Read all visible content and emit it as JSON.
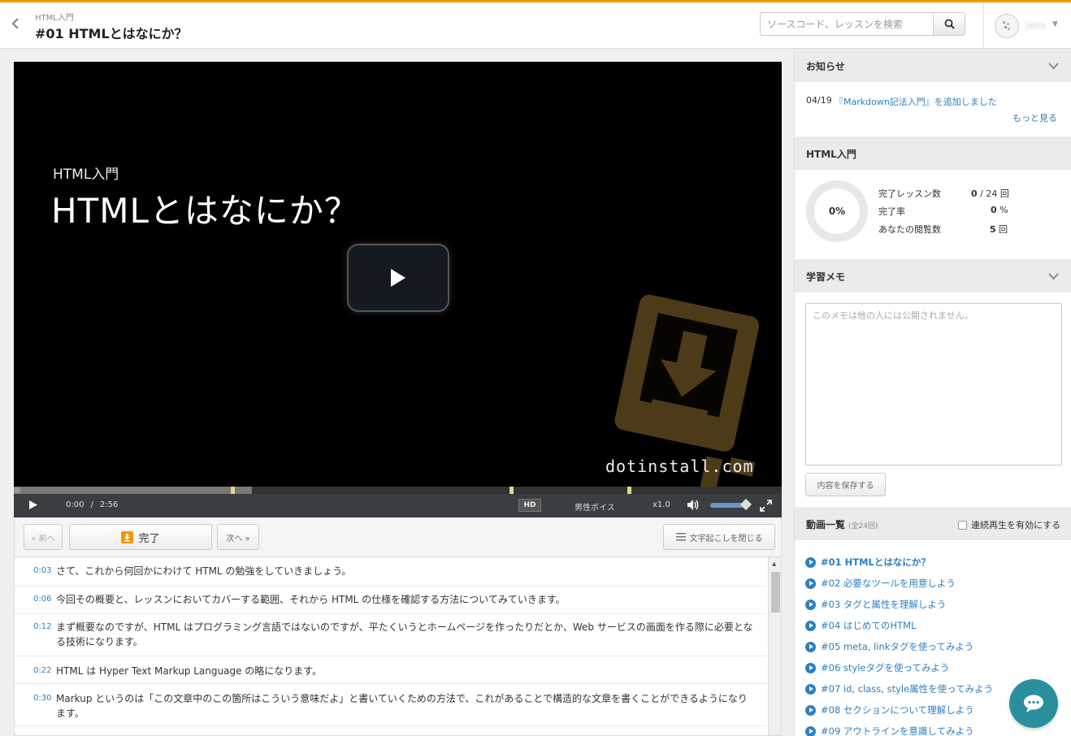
{
  "header": {
    "breadcrumb": "HTML入門",
    "title": "#01 HTMLとはなにか？",
    "search_placeholder": "ソースコード、レッスンを検索",
    "username": "jatro"
  },
  "video": {
    "subtitle": "HTML入門",
    "title": "HTMLとはなにか？",
    "watermark": "dotinstall.com",
    "progress": 0.0,
    "buffered": 0.31
  },
  "controls": {
    "current_time": "0:00",
    "separator": "/",
    "duration": "2:56",
    "hd_label": "HD",
    "voice_label": "男性ボイス",
    "speed_label": "x1.0",
    "volume": 0.9
  },
  "lesson_nav": {
    "prev_label": "« 前へ",
    "done_label": "完了",
    "next_label": "次へ »",
    "close_transcript_label": "文字起こしを閉じる"
  },
  "transcript": [
    {
      "time": "0:03",
      "text": "さて、これから何回かにわけて HTML の勉強をしていきましょう。"
    },
    {
      "time": "0:06",
      "text": "今回その概要と、レッスンにおいてカバーする範囲、それから HTML の仕様を確認する方法についてみていきます。"
    },
    {
      "time": "0:12",
      "text": "まず概要なのですが、HTML はプログラミング言語ではないのですが、平たくいうとホームページを作ったりだとか、Web サービスの画面を作る際に必要となる技術になります。"
    },
    {
      "time": "0:22",
      "text": "HTML は Hyper Text Markup Language の略になります。"
    },
    {
      "time": "0:30",
      "text": "Markup というのは「この文章中のこの箇所はこういう意味だよ」と書いていくための方法で、これがあることで構造的な文章を書くことができるようになります。"
    }
  ],
  "sidebar": {
    "news": {
      "heading": "お知らせ",
      "date": "04/19",
      "link": "『Markdown記法入門』を追加しました",
      "more": "もっと見る"
    },
    "course": {
      "heading": "HTML入門",
      "percent_label": "0%",
      "stats": [
        {
          "label": "完了レッスン数",
          "value": "0",
          "total": "/ 24",
          "unit": "回"
        },
        {
          "label": "完了率",
          "value": "0",
          "total": "",
          "unit": "%"
        },
        {
          "label": "あなたの閲覧数",
          "value": "5",
          "total": "",
          "unit": "回"
        }
      ]
    },
    "memo": {
      "heading": "学習メモ",
      "placeholder": "このメモは他の人には公開されません。",
      "save_label": "内容を保存する"
    },
    "videos": {
      "heading": "動画一覧",
      "count": "(全24回)",
      "autoplay_label": "連続再生を有効にする",
      "items": [
        "#01 HTMLとはなにか？",
        "#02 必要なツールを用意しよう",
        "#03 タグと属性を理解しよう",
        "#04 はじめてのHTML",
        "#05 meta, linkタグを使ってみよう",
        "#06 styleタグを使ってみよう",
        "#07 id, class, style属性を使ってみよう",
        "#08 セクションについて理解しよう",
        "#09 アウトラインを意識してみよう"
      ]
    }
  },
  "colors": {
    "accent": "#f39800",
    "link": "#2e7fc2",
    "chat": "#2a8f9d"
  }
}
